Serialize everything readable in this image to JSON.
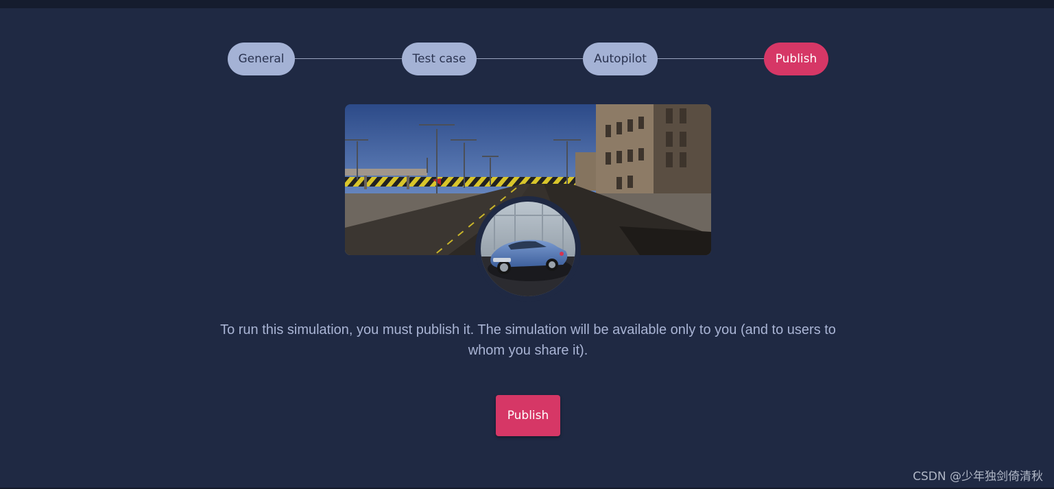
{
  "stepper": {
    "steps": [
      {
        "label": "General",
        "state": "completed"
      },
      {
        "label": "Test case",
        "state": "completed"
      },
      {
        "label": "Autopilot",
        "state": "completed"
      },
      {
        "label": "Publish",
        "state": "active"
      }
    ]
  },
  "hero": {
    "scene_icon": "city-road-scene-image",
    "vehicle_icon": "vehicle-avatar-image"
  },
  "main": {
    "description": "To run this simulation, you must publish it. The simulation will be available only to you (and to users to whom you share it).",
    "publish_button_label": "Publish"
  },
  "watermark": "CSDN @少年独剑倚清秋",
  "colors": {
    "background": "#1f2943",
    "accent": "#d63766",
    "step_inactive": "#a4b2d5",
    "text_muted": "#a9b4d4"
  }
}
